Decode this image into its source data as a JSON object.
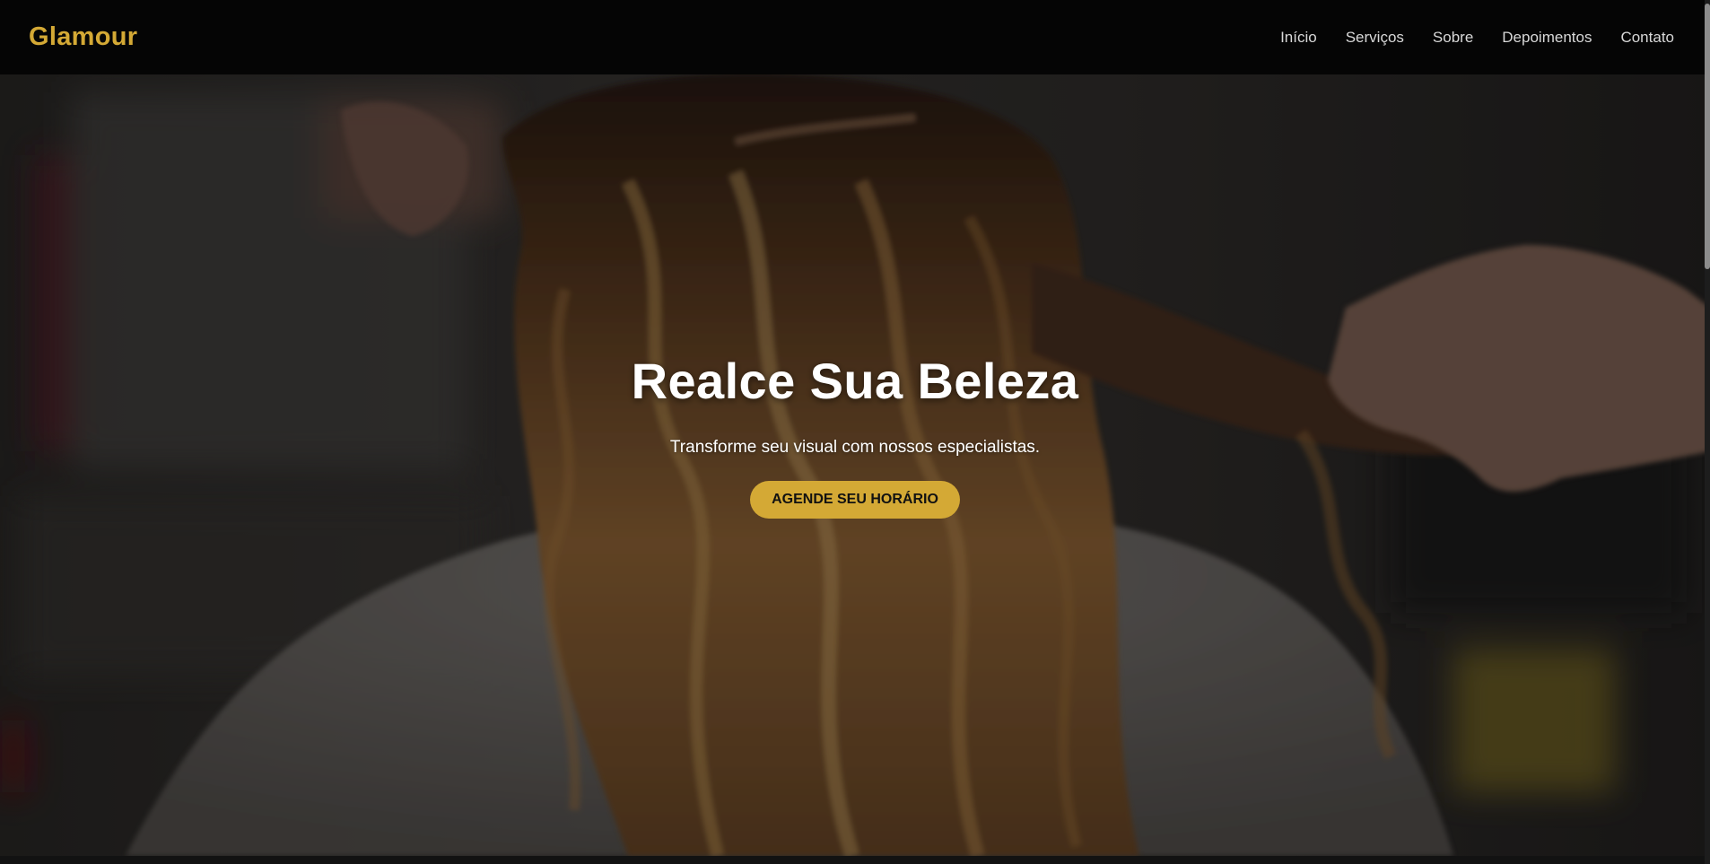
{
  "brand": {
    "name": "Glamour",
    "accent_color": "#d4a935"
  },
  "nav": {
    "links": [
      {
        "label": "Início"
      },
      {
        "label": "Serviços"
      },
      {
        "label": "Sobre"
      },
      {
        "label": "Depoimentos"
      },
      {
        "label": "Contato"
      }
    ]
  },
  "hero": {
    "title": "Realce Sua Beleza",
    "subtitle": "Transforme seu visual com nossos especialistas.",
    "cta_label": "AGENDE SEU HORÁRIO",
    "background_image": "hairdresser-styling-long-curly-highlighted-hair"
  }
}
